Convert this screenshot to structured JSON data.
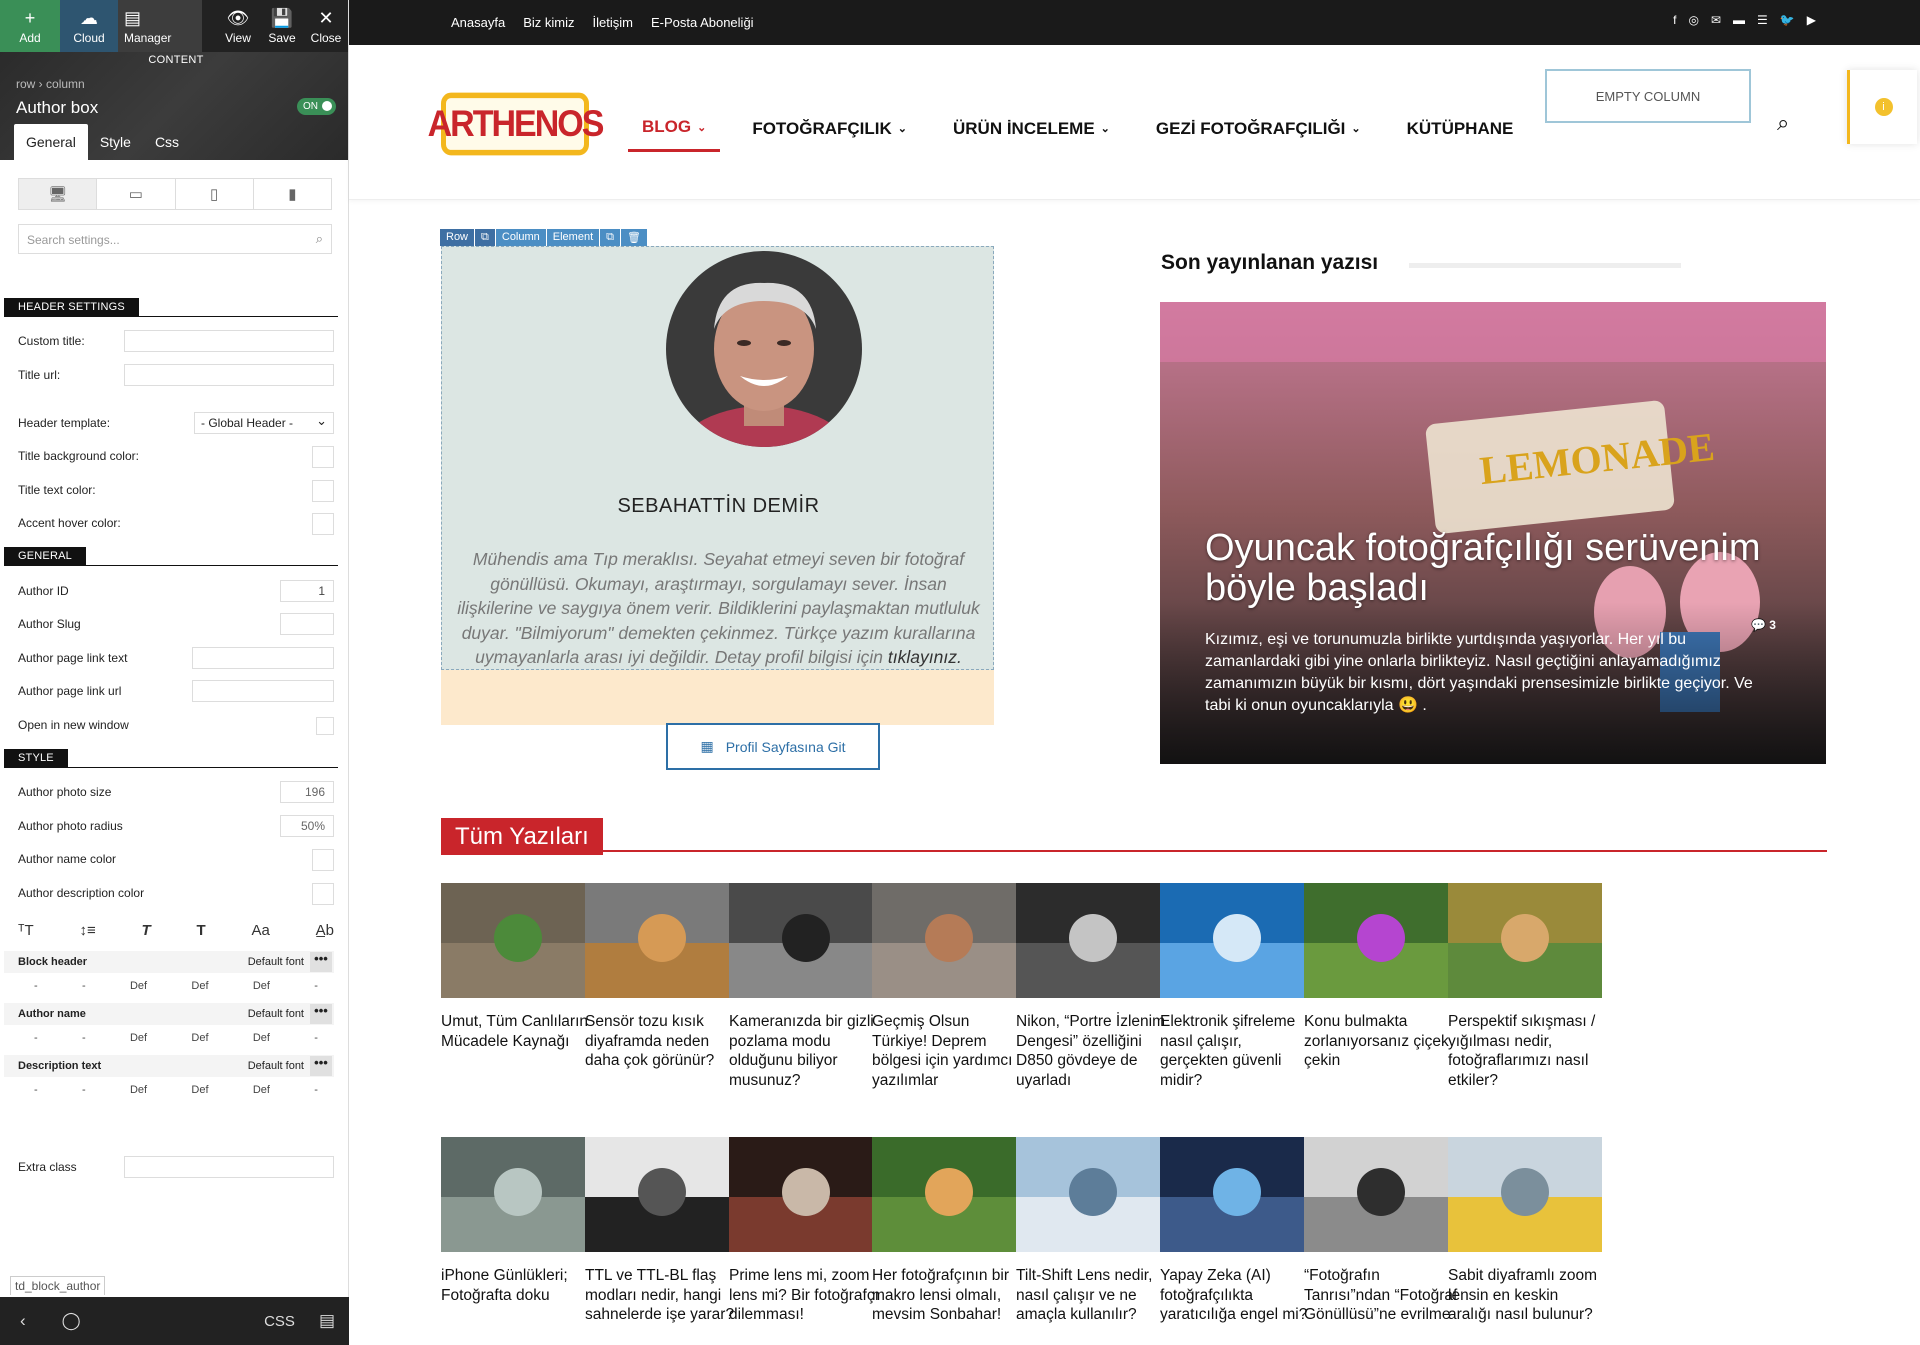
{
  "editor": {
    "toolbar": {
      "add": "Add",
      "cloud": "Cloud",
      "manager": "Manager",
      "view": "View",
      "save": "Save",
      "close": "Close",
      "content": "CONTENT"
    },
    "header": {
      "breadcrumb_row": "row",
      "breadcrumb_col": "column",
      "title": "Author box",
      "toggle": "ON"
    },
    "tabs": [
      "General",
      "Style",
      "Css"
    ],
    "search_placeholder": "Search settings...",
    "header_settings": "HEADER SETTINGS",
    "custom_title": "Custom title:",
    "title_url": "Title url:",
    "header_template": "Header template:",
    "header_template_value": "- Global Header -",
    "title_bg": "Title background color:",
    "title_text": "Title text color:",
    "accent_hover": "Accent hover color:",
    "general": "GENERAL",
    "author_id": "Author ID",
    "author_id_value": "1",
    "author_slug": "Author Slug",
    "author_page_link_text": "Author page link text",
    "author_page_link_url": "Author page link url",
    "open_new_window": "Open in new window",
    "style": "STYLE",
    "photo_size": "Author photo size",
    "photo_size_value": "196",
    "photo_radius": "Author photo radius",
    "photo_radius_value": "50%",
    "name_color": "Author name color",
    "desc_color": "Author description color",
    "block_header": "Block header",
    "author_name": "Author name",
    "description_text": "Description text",
    "default_font": "Default font",
    "def": "Def",
    "dash": "-",
    "extra_class": "Extra class",
    "td_tag": "td_block_author",
    "css_btn": "CSS"
  },
  "site": {
    "topnav": [
      "Anasayfa",
      "Biz kimiz",
      "İletişim",
      "E-Posta Aboneliği"
    ],
    "logo": "ARTHENOS",
    "nav": [
      {
        "label": "BLOG",
        "caret": "⌄"
      },
      {
        "label": "FOTOĞRAFÇILIK",
        "caret": "⌄"
      },
      {
        "label": "ÜRÜN İNCELEME",
        "caret": "⌄"
      },
      {
        "label": "GEZİ FOTOĞRAFÇILIĞI",
        "caret": "⌄"
      },
      {
        "label": "KÜTÜPHANE",
        "caret": ""
      }
    ],
    "empty_column": "EMPTY COLUMN",
    "rowtag": {
      "row": "Row",
      "column": "Column",
      "element": "Element"
    },
    "author": {
      "name": "SEBAHATTİN DEMİR",
      "desc": "Mühendis ama Tıp meraklısı. Seyahat etmeyi seven bir fotoğraf gönüllüsü. Okumayı, araştırmayı, sorgulamayı sever. İnsan ilişkilerine ve saygıya önem verir. Bildiklerini paylaşmaktan mutluluk duyar. \"Bilmiyorum\" demekten çekinmez. Türkçe yazım kurallarına uymayanlarla arası iyi değildir. Detay profil bilgisi için",
      "desc_link": "tıklayınız.",
      "button": "Profil Sayfasına Git"
    },
    "latest_title": "Son yayınlanan yazısı",
    "hero": {
      "title": "Oyuncak fotoğrafçılığı serüvenim böyle başladı",
      "excerpt": "Kızımız, eşi ve torunumuzla birlikte yurtdışında yaşıyorlar. Her yıl bu zamanlardaki gibi yine onlarla birlikteyiz. Nasıl geçtiğini anlayamadığımız zamanımızın büyük bir kısmı, dört yaşındaki prensesimizle birlikte geçiyor. Ve tabi ki onun oyuncaklarıyla 😃 .",
      "comments": "3",
      "sign": "LEMONADE"
    },
    "section_title": "Tüm Yazıları",
    "posts": [
      {
        "title": "Umut, Tüm Canlıların Mücadele Kaynağı"
      },
      {
        "title": "Sensör tozu kısık diyaframda neden daha çok görünür?"
      },
      {
        "title": "Kameranızda bir gizli pozlama modu olduğunu biliyor musunuz?"
      },
      {
        "title": "Geçmiş Olsun Türkiye! Deprem bölgesi için yardımcı yazılımlar"
      },
      {
        "title": "Nikon, “Portre İzlenim Dengesi” özelliğini D850 gövdeye de uyarladı"
      },
      {
        "title": "Elektronik şifreleme nasıl çalışır, gerçekten güvenli midir?"
      },
      {
        "title": "Konu bulmakta zorlanıyorsanız çiçek çekin"
      },
      {
        "title": "Perspektif sıkışması / yığılması nedir, fotoğraflarımızı nasıl etkiler?"
      },
      {
        "title": "iPhone Günlükleri; Fotoğrafta doku"
      },
      {
        "title": "TTL ve TTL-BL flaş modları nedir, hangi sahnelerde işe yarar?"
      },
      {
        "title": "Prime lens mi, zoom lens mi? Bir fotoğrafçı dilemması!"
      },
      {
        "title": "Her fotoğrafçının bir makro lensi olmalı, mevsim Sonbahar!"
      },
      {
        "title": "Tilt-Shift Lens nedir, nasıl çalışır ve ne amaçla kullanılır?"
      },
      {
        "title": "Yapay Zeka (AI) fotoğrafçılıkta yaratıcılığa engel mi?"
      },
      {
        "title": "“Fotoğrafın Tanrısı”ndan “Fotoğraf Gönüllüsü”ne evrilme"
      },
      {
        "title": "Sabit diyaframlı zoom lensin en keskin aralığı nasıl bulunur?"
      }
    ]
  }
}
